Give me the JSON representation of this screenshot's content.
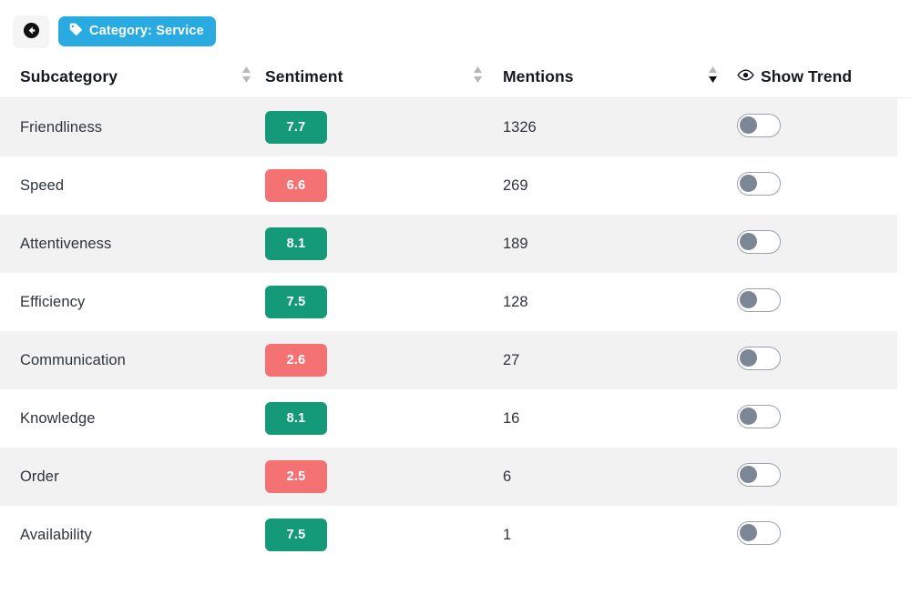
{
  "toolbar": {
    "back_button_label": "",
    "back_icon": "arrow-left-circle-icon",
    "category_tag": {
      "icon": "tag-icon",
      "label": "Category: Service"
    }
  },
  "table": {
    "columns": [
      {
        "key": "subcategory",
        "label": "Subcategory",
        "sortable": true,
        "sort_state": "none"
      },
      {
        "key": "sentiment",
        "label": "Sentiment",
        "sortable": true,
        "sort_state": "none"
      },
      {
        "key": "mentions",
        "label": "Mentions",
        "sortable": true,
        "sort_state": "desc"
      },
      {
        "key": "show_trend",
        "label": "Show Trend",
        "icon": "eye-icon",
        "sortable": false,
        "sort_state": "none"
      }
    ],
    "rows": [
      {
        "subcategory": "Friendliness",
        "sentiment": "7.7",
        "tone": "pos",
        "mentions": "1326",
        "show_trend": false
      },
      {
        "subcategory": "Speed",
        "sentiment": "6.6",
        "tone": "neg",
        "mentions": "269",
        "show_trend": false
      },
      {
        "subcategory": "Attentiveness",
        "sentiment": "8.1",
        "tone": "pos",
        "mentions": "189",
        "show_trend": false
      },
      {
        "subcategory": "Efficiency",
        "sentiment": "7.5",
        "tone": "pos",
        "mentions": "128",
        "show_trend": false
      },
      {
        "subcategory": "Communication",
        "sentiment": "2.6",
        "tone": "neg",
        "mentions": "27",
        "show_trend": false
      },
      {
        "subcategory": "Knowledge",
        "sentiment": "8.1",
        "tone": "pos",
        "mentions": "16",
        "show_trend": false
      },
      {
        "subcategory": "Order",
        "sentiment": "2.5",
        "tone": "neg",
        "mentions": "6",
        "show_trend": false
      },
      {
        "subcategory": "Availability",
        "sentiment": "7.5",
        "tone": "pos",
        "mentions": "1",
        "show_trend": false
      }
    ]
  },
  "colors": {
    "accent_blue": "#29abe2",
    "positive_green": "#159a79",
    "negative_red": "#f47174",
    "stripe_gray": "#f2f2f2",
    "toggle_knob": "#7b8794"
  }
}
